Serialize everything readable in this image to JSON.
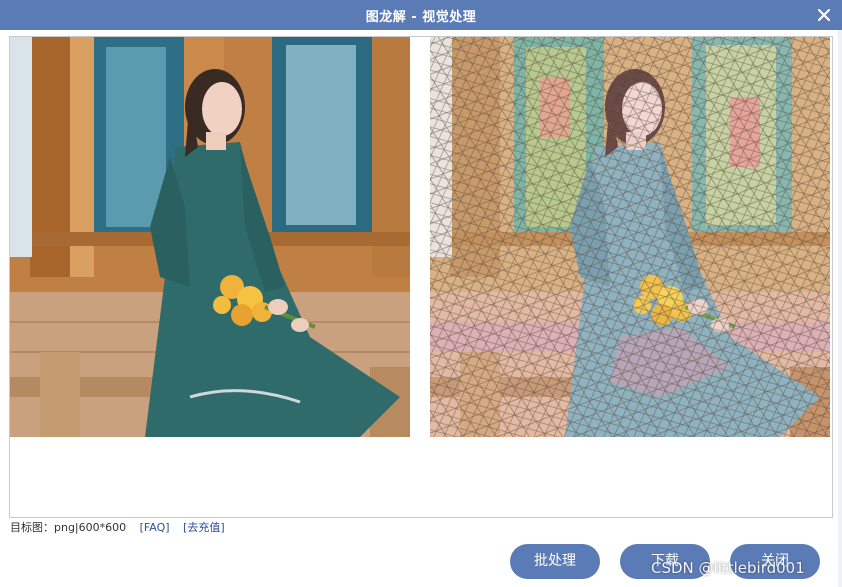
{
  "window": {
    "title": "图龙解 - 视觉处理",
    "accent_color": "#5b7bb6"
  },
  "preview": {
    "original_image": "photo-woman-in-teal-dress-with-sunflowers",
    "processed_image": "stained-glass-style-filtered-photo"
  },
  "info": {
    "target_label": "目标图：png|600*600",
    "faq_link": "[FAQ]",
    "recharge_link": "[去充值]"
  },
  "buttons": {
    "batch_label": "批处理",
    "download_label": "下载",
    "close_label": "关闭"
  },
  "watermark": "CSDN @littlebird001"
}
